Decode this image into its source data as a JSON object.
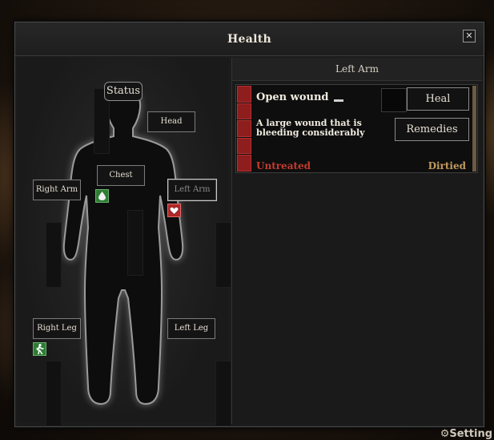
{
  "window": {
    "title": "Health"
  },
  "body": {
    "status_label": "Status",
    "parts": {
      "head": "Head",
      "chest": "Chest",
      "right_arm": "Right Arm",
      "left_arm": "Left Arm",
      "right_leg": "Right Leg",
      "left_leg": "Left Leg"
    },
    "selected_part": "Left Arm",
    "status_icons": [
      "blood-drop-icon",
      "heart-icon",
      "walking-icon"
    ]
  },
  "detail": {
    "header": "Left Arm",
    "wound": {
      "name": "Open wound",
      "description": "A large wound that is bleeding considerably",
      "treatment_status": "Untreated",
      "cleanliness": "Dirtied",
      "heal_label": "Heal",
      "remedies_label": "Remedies"
    }
  },
  "footer": {
    "settings_label": "Setting"
  },
  "colors": {
    "untreated": "#c63a2e",
    "dirtied": "#c49a5e",
    "severity": "#8e1d1d",
    "icon_green": "#2e7d34",
    "icon_red": "#b02828"
  }
}
